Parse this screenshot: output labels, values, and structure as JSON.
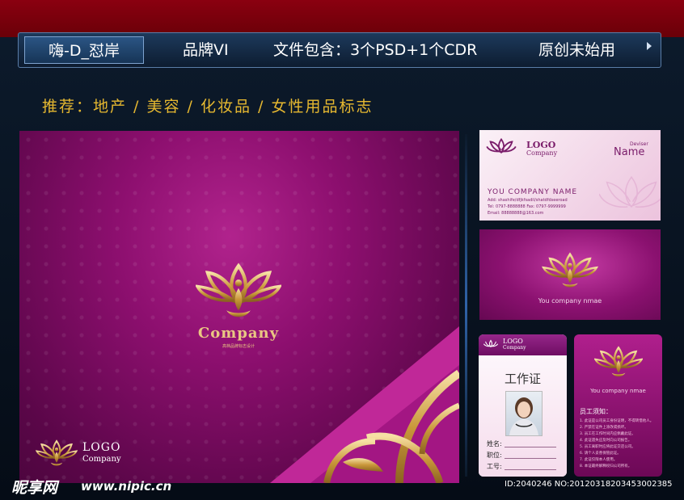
{
  "topbar": {
    "brand": "嗨-D_怼岸",
    "item1": "品牌VI",
    "item2": "文件包含：3个PSD+1个CDR",
    "item3": "原创未始用"
  },
  "recommend": "推荐：地产 / 美容 / 化妆品 / 女性用品标志",
  "main_panel": {
    "company": "Company",
    "company_sub": "高档品牌标志设计",
    "logo_title": "LOGO",
    "logo_sub": "Company"
  },
  "business_card": {
    "logo": "LOGO",
    "company": "Company",
    "deviser": "Deviser",
    "name": "Name",
    "your_company": "YOU COMPANY  NAME",
    "add": "Add: shashife/dfjkfsadil/shatdfdseeroad",
    "tel": "Tel: 0797-8888888  Fax: 0797-9999999",
    "email": "Email: 88888888@163.com"
  },
  "card2": {
    "text": "You company nmae"
  },
  "id_card": {
    "logo": "LOGO",
    "company": "Company",
    "title": "工作证",
    "name_label": "姓名:",
    "position_label": "职位:",
    "number_label": "工号:"
  },
  "id_card_back": {
    "text": "You company nmae",
    "notice": "员工须知：",
    "rules": [
      "1. 此证是公司员工身份证明，不得转借他人。",
      "2. 严禁在证件上涂改或损坏。",
      "3. 员工在工作时间内应佩戴此证。",
      "4. 此证遗失应及时向公司报告。",
      "5. 员工离职时应将此证交还公司。",
      "6. 请个人妥善保管此证。",
      "7. 此证仅限本人使用。",
      "8. 本证最终解释权归公司所有。"
    ]
  },
  "watermark": {
    "logo": "昵享网",
    "url": "www.nipic.cn",
    "id": "ID:2040246 NO:20120318203453002385"
  },
  "colors": {
    "accent_gold": "#e6b830",
    "magenta": "#8d0f6f",
    "top_red": "#8a0010",
    "navy": "#0c1a2b"
  }
}
